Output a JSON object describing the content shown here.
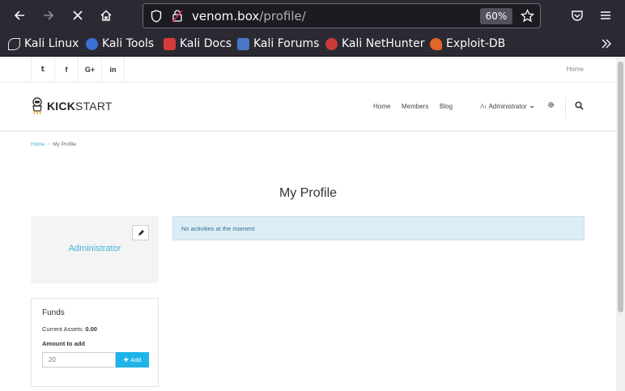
{
  "browser": {
    "url_host": "venom.box",
    "url_path": "/profile/",
    "zoom": "60%",
    "bookmarks": [
      {
        "label": "Kali Linux",
        "color": "#e6e6e6"
      },
      {
        "label": "Kali Tools",
        "color": "#3b6fd6"
      },
      {
        "label": "Kali Docs",
        "color": "#d63b3b"
      },
      {
        "label": "Kali Forums",
        "color": "#4a78c9"
      },
      {
        "label": "Kali NetHunter",
        "color": "#c93b3b"
      },
      {
        "label": "Exploit-DB",
        "color": "#e0662a"
      }
    ]
  },
  "topbar": {
    "social": [
      "twitter-icon",
      "facebook-icon",
      "google-plus-icon",
      "linkedin-icon"
    ],
    "social_glyphs": [
      "𝕥",
      "f",
      "G+",
      "in"
    ],
    "home_link": "Home"
  },
  "header": {
    "logo_bold": "KICK",
    "logo_rest": "START",
    "nav": {
      "home": "Home",
      "members": "Members",
      "blog": "Blog",
      "user_prefix": "Aı",
      "user": "Administrator"
    }
  },
  "breadcrumb": {
    "home": "Home",
    "current": "My Profile"
  },
  "page": {
    "title": "My Profile",
    "profile_name": "Administrator",
    "activity_message": "No activities at the moment"
  },
  "funds": {
    "title": "Funds",
    "assets_label": "Current Assets:",
    "assets_value": "0.00",
    "amount_label": "Amount to add",
    "amount_placeholder": "20",
    "add_label": "Add"
  },
  "colors": {
    "accent": "#3fb5d9",
    "add_button": "#1eb4ea",
    "alert_bg": "#dcedf5"
  }
}
